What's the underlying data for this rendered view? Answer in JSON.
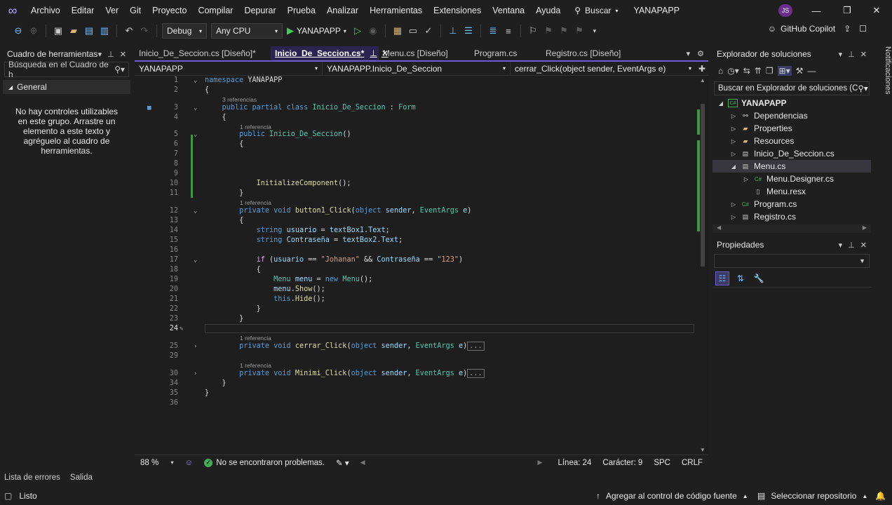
{
  "menubar": {
    "items": [
      "Archivo",
      "Editar",
      "Ver",
      "Git",
      "Proyecto",
      "Compilar",
      "Depurar",
      "Prueba",
      "Analizar",
      "Herramientas",
      "Extensiones",
      "Ventana",
      "Ayuda"
    ],
    "search_label": "Buscar",
    "app_title": "YANAPAPP",
    "avatar_initials": "JS"
  },
  "toolbar": {
    "config": "Debug",
    "platform": "Any CPU",
    "run_target": "YANAPAPP",
    "copilot_label": "GitHub Copilot"
  },
  "toolbox": {
    "title": "Cuadro de herramientas",
    "search_placeholder": "Búsqueda en el Cuadro de h",
    "group": "General",
    "empty_message": "No hay controles utilizables en este grupo. Arrastre un elemento a este texto y agréguelo al cuadro de herramientas."
  },
  "editor": {
    "tabs": [
      {
        "label": "Inicio_De_Seccion.cs [Diseño]*",
        "active": false
      },
      {
        "label": "Inicio_De_Seccion.cs*",
        "active": true
      },
      {
        "label": "Menu.cs [Diseño]",
        "active": false
      },
      {
        "label": "Program.cs",
        "active": false
      },
      {
        "label": "Registro.cs [Diseño]",
        "active": false
      }
    ],
    "nav_project": "YANAPAPP",
    "nav_class": "YANAPAPP.Inicio_De_Seccion",
    "nav_member": "cerrar_Click(object sender, EventArgs e)",
    "refs": {
      "three": "3 referencias",
      "one": "1 referencia"
    },
    "line_numbers": [
      "1",
      "2",
      "3",
      "4",
      "5",
      "6",
      "7",
      "8",
      "9",
      "10",
      "11",
      "12",
      "13",
      "14",
      "15",
      "16",
      "17",
      "18",
      "19",
      "20",
      "21",
      "22",
      "23",
      "24",
      "25",
      "29",
      "30",
      "34",
      "35",
      "36"
    ],
    "collapsed_marker": "..."
  },
  "statusbar": {
    "zoom": "88 %",
    "problems": "No se encontraron problemas.",
    "line": "Línea: 24",
    "char": "Carácter: 9",
    "spc": "SPC",
    "eol": "CRLF"
  },
  "solution_explorer": {
    "title": "Explorador de soluciones",
    "search_placeholder": "Buscar en Explorador de soluciones (C",
    "items": [
      {
        "label": "YANAPAPP",
        "bold": true
      },
      {
        "label": "Dependencias"
      },
      {
        "label": "Properties"
      },
      {
        "label": "Resources"
      },
      {
        "label": "Inicio_De_Seccion.cs"
      },
      {
        "label": "Menu.cs"
      },
      {
        "label": "Menu.Designer.cs"
      },
      {
        "label": "Menu.resx"
      },
      {
        "label": "Program.cs"
      },
      {
        "label": "Registro.cs"
      }
    ]
  },
  "properties": {
    "title": "Propiedades"
  },
  "notifications_label": "Notificaciones",
  "bottom_tabs": [
    "Lista de errores",
    "Salida"
  ],
  "bottom_status": {
    "ready": "Listo",
    "source_control": "Agregar al control de código fuente",
    "repository": "Seleccionar repositorio"
  }
}
